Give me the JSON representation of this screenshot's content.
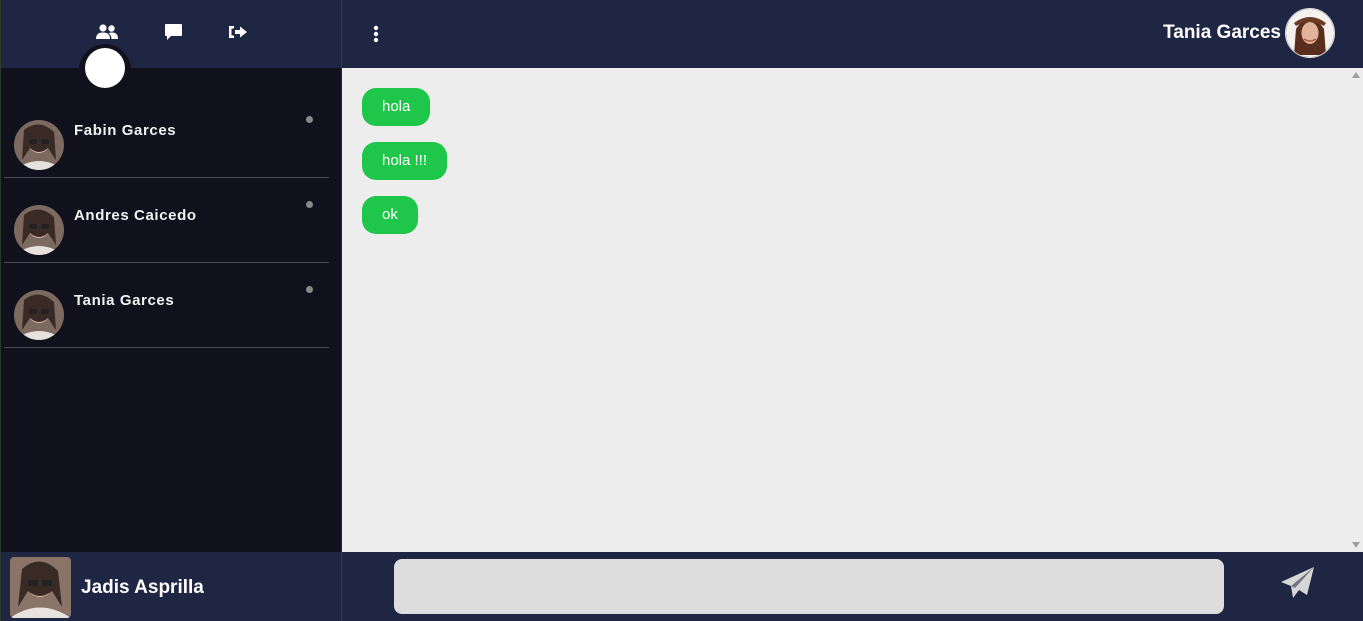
{
  "sidebar": {
    "contacts": [
      {
        "name": "Fabin Garces"
      },
      {
        "name": "Andres Caicedo"
      },
      {
        "name": "Tania Garces"
      }
    ],
    "me": {
      "name": "Jadis Asprilla"
    }
  },
  "chat": {
    "header_name": "Tania Garces",
    "messages": [
      {
        "text": "hola"
      },
      {
        "text": "hola !!!"
      },
      {
        "text": "ok"
      }
    ]
  },
  "colors": {
    "accent_green": "#1ec74a",
    "header_bg": "#1f2643",
    "sidebar_bg": "#11111d",
    "chat_bg": "#eeedee"
  },
  "icons": [
    "users-icon",
    "chat-bubble-icon",
    "logout-icon",
    "vertical-dots-icon",
    "send-icon"
  ]
}
